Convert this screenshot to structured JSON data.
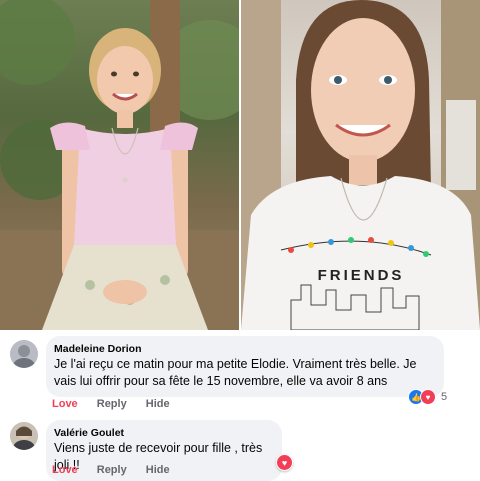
{
  "colors": {
    "love": "#f33e58",
    "like": "#1877f2",
    "bubble": "#f0f2f5",
    "action": "#65676b"
  },
  "photos": [
    {
      "name": "girl-in-pink-top-photo"
    },
    {
      "name": "girl-in-friends-tshirt-photo",
      "shirt_text": "FRIENDS"
    }
  ],
  "comments": [
    {
      "author": "Madeleine Dorion",
      "text": "Je l'ai reçu ce matin pour ma petite Elodie. Vraiment très belle. Je vais lui offrir pour sa fête le 15 novembre, elle va avoir 8 ans",
      "actions": {
        "love": "Love",
        "reply": "Reply",
        "hide": "Hide"
      },
      "reactions": {
        "icons": [
          "like-icon",
          "heart-icon"
        ],
        "count": "5"
      }
    },
    {
      "author": "Valérie Goulet",
      "text": "Viens juste de recevoir pour fille , très joli !!",
      "actions": {
        "love": "Love",
        "reply": "Reply",
        "hide": "Hide"
      },
      "reactions": {
        "icons": [
          "heart-icon"
        ]
      }
    }
  ]
}
